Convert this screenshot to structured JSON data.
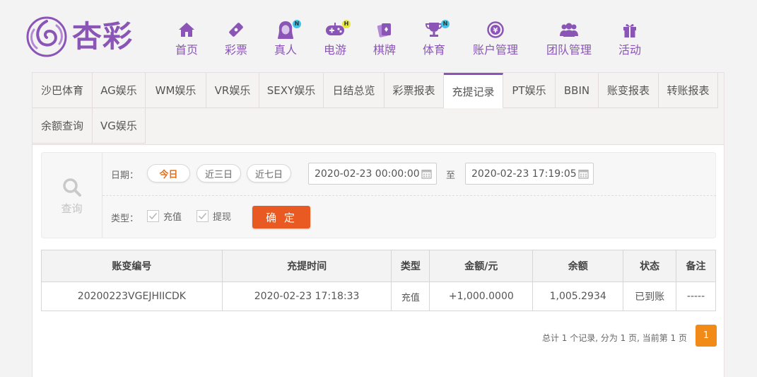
{
  "brand": {
    "name": "杏彩"
  },
  "nav": [
    {
      "label": "首页",
      "icon": "home-icon",
      "badge": ""
    },
    {
      "label": "彩票",
      "icon": "lottery-ticket-icon",
      "badge": ""
    },
    {
      "label": "真人",
      "icon": "live-dealer-icon",
      "badge": "N"
    },
    {
      "label": "电游",
      "icon": "gamepad-icon",
      "badge": "H"
    },
    {
      "label": "棋牌",
      "icon": "playing-cards-icon",
      "badge": ""
    },
    {
      "label": "体育",
      "icon": "trophy-icon",
      "badge": "N"
    },
    {
      "label": "账户管理",
      "icon": "yen-coin-icon",
      "badge": ""
    },
    {
      "label": "团队管理",
      "icon": "team-icon",
      "badge": ""
    },
    {
      "label": "活动",
      "icon": "gift-icon",
      "badge": ""
    }
  ],
  "tabs": [
    "沙巴体育",
    "AG娱乐",
    "WM娱乐",
    "VR娱乐",
    "SEXY娱乐",
    "日结总览",
    "彩票报表",
    "充提记录",
    "PT娱乐",
    "BBIN",
    "账变报表",
    "转账报表",
    "余额查询",
    "VG娱乐"
  ],
  "active_tab": "充提记录",
  "query": {
    "side_label": "查询",
    "date_label": "日期：",
    "quick_ranges": [
      "今日",
      "近三日",
      "近七日"
    ],
    "selected_range": "今日",
    "start": "2020-02-23 00:00:00",
    "to_label": "至",
    "end": "2020-02-23 17:19:05",
    "type_label": "类型：",
    "types": [
      "充值",
      "提现"
    ],
    "confirm": "确 定"
  },
  "table": {
    "headers": [
      "账变编号",
      "充提时间",
      "类型",
      "金额/元",
      "余额",
      "状态",
      "备注"
    ],
    "rows": [
      [
        "20200223VGEJHIICDK",
        "2020-02-23 17:18:33",
        "充值",
        "+1,000.0000",
        "1,005.2934",
        "已到账",
        "-----"
      ]
    ]
  },
  "pager": {
    "summary": "总计 1 个记录, 分为 1 页, 当前第 1 页",
    "current": "1"
  },
  "colors": {
    "brand_purple": "#8a55b6",
    "confirm_orange": "#e85a22",
    "pager_orange": "#f28a18",
    "amount_red": "#d31a1a",
    "status_green": "#3aa018"
  }
}
